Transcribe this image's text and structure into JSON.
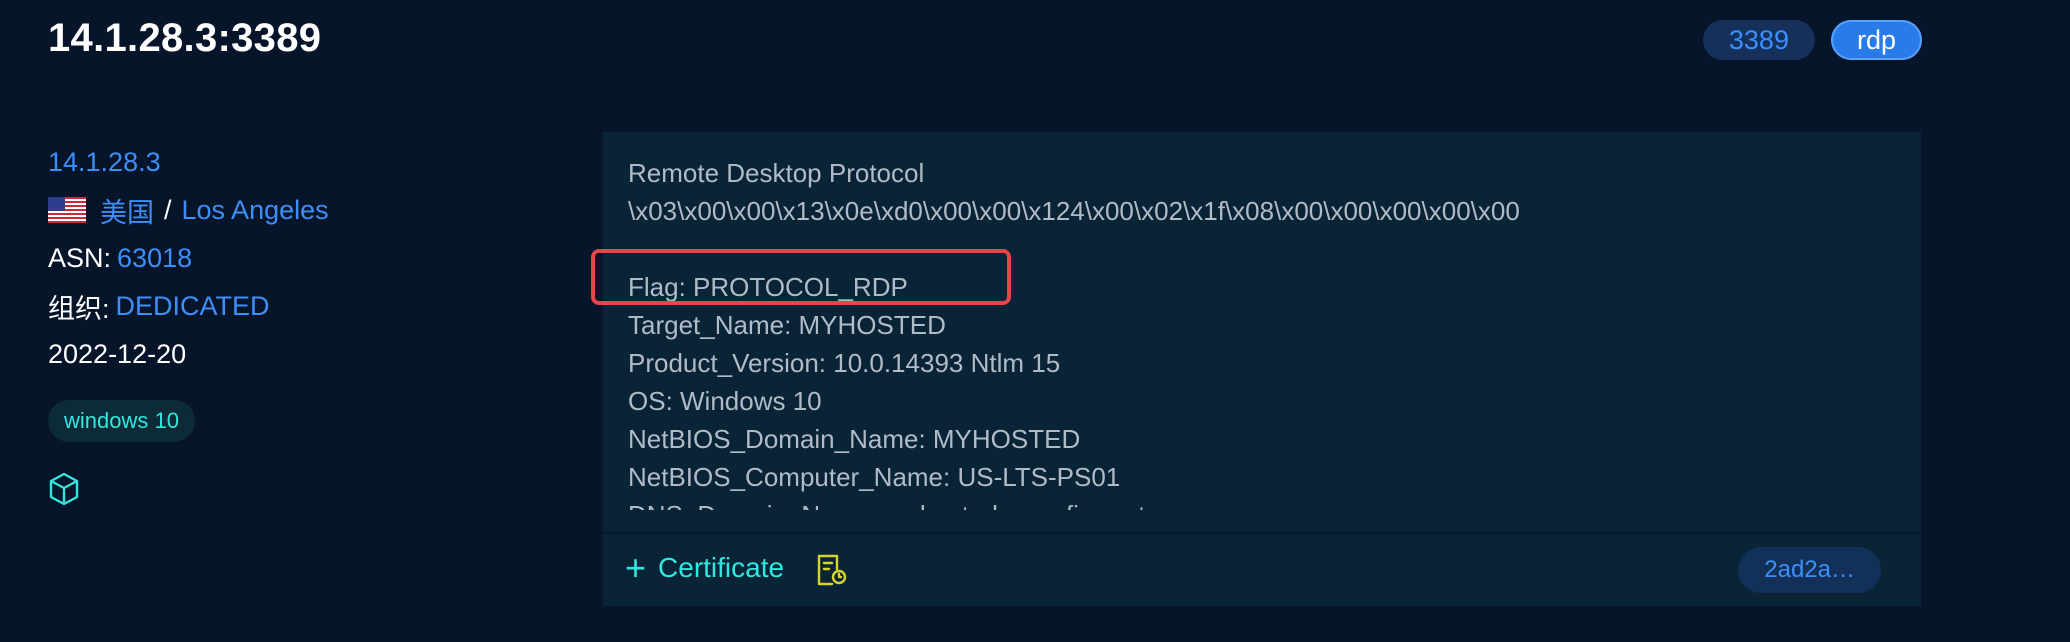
{
  "header": {
    "title": "14.1.28.3:3389",
    "port_tag": "3389",
    "protocol_tag": "rdp"
  },
  "info": {
    "ip": "14.1.28.3",
    "country": "美国",
    "separator": "/",
    "city": "Los Angeles",
    "asn_label": "ASN:",
    "asn_value": "63018",
    "org_label": "组织:",
    "org_value": "DEDICATED",
    "date": "2022-12-20",
    "os_tag": "windows 10",
    "flag_icon": "us-flag-icon",
    "cube_icon": "cube-icon"
  },
  "banner": {
    "lines": [
      "Remote Desktop Protocol",
      "\\x03\\x00\\x00\\x13\\x0e\\xd0\\x00\\x00\\x124\\x00\\x02\\x1f\\x08\\x00\\x00\\x00\\x00\\x00",
      "",
      "Flag: PROTOCOL_RDP",
      "Target_Name: MYHOSTED",
      "Product_Version: 10.0.14393 Ntlm 15",
      "OS: Windows 10",
      "NetBIOS_Domain_Name: MYHOSTED",
      "NetBIOS_Computer_Name: US-LTS-PS01",
      "DNS_Domain_Name: myhosted.wavefire.net"
    ]
  },
  "footer": {
    "certificate_label": "Certificate",
    "plus_symbol": "+",
    "hash": "2ad2a…"
  },
  "colors": {
    "background": "#07152b",
    "panel": "#0a2437",
    "link": "#3e8ef7",
    "accent_cyan": "#2ee8e0",
    "highlight_red": "#e6454a"
  }
}
